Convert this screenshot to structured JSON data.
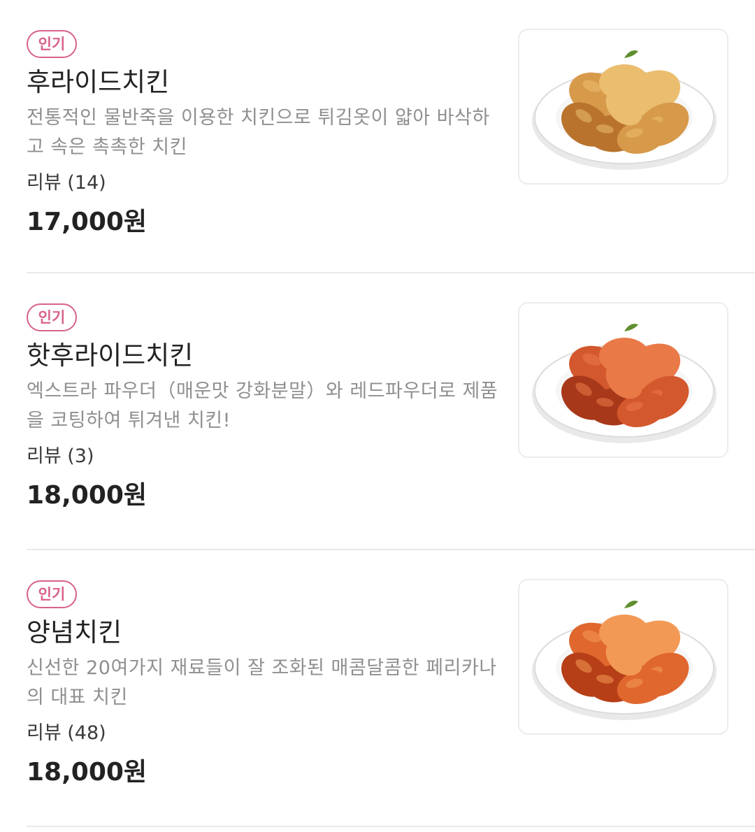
{
  "menu": {
    "items": [
      {
        "badge": "인기",
        "name": "후라이드치킨",
        "description": "전통적인 물반죽을 이용한 치킨으로 튀김옷이 얇아 바삭하고 속은 촉촉한 치킨",
        "review": "리뷰 (14)",
        "price": "17,000원",
        "image_icon": "fried-chicken-photo",
        "colors": {
          "main": "#d79a4b",
          "dark": "#b9732d",
          "light": "#ebbd6f"
        }
      },
      {
        "badge": "인기",
        "name": "핫후라이드치킨",
        "description": "엑스트라 파우더（매운맛 강화분말）와 레드파우더로 제품을 코팅하여 튀겨낸 치킨!",
        "review": "리뷰 (3)",
        "price": "18,000원",
        "image_icon": "hot-fried-chicken-photo",
        "colors": {
          "main": "#d4582d",
          "dark": "#a8381a",
          "light": "#e97a47"
        }
      },
      {
        "badge": "인기",
        "name": "양념치킨",
        "description": "신선한 20여가지 재료들이 잘 조화된 매콤달콤한 페리카나의 대표 치킨",
        "review": "리뷰 (48)",
        "price": "18,000원",
        "image_icon": "seasoned-chicken-photo",
        "colors": {
          "main": "#e0672e",
          "dark": "#b63f17",
          "light": "#f29a55"
        }
      }
    ]
  },
  "theme": {
    "badge_color": "#d8618a",
    "divider_color": "#e9e9e9",
    "description_color": "#8f8f8f"
  }
}
